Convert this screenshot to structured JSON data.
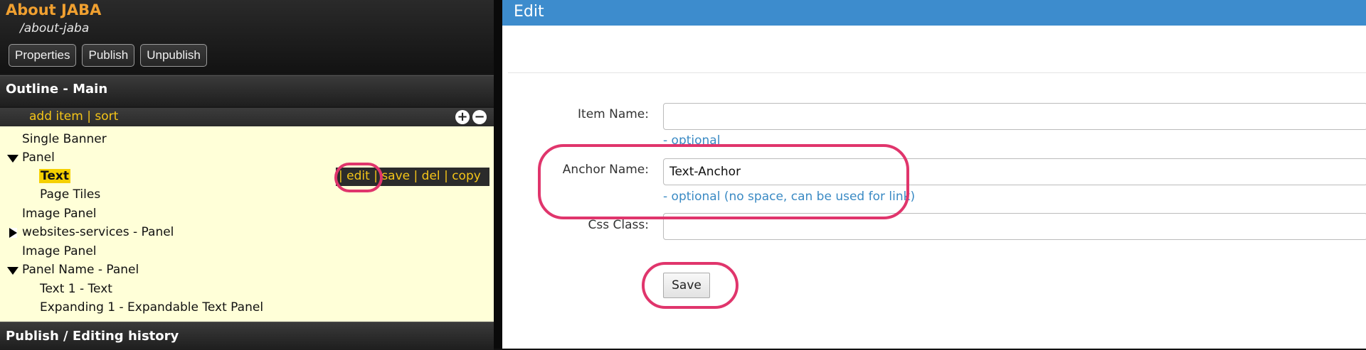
{
  "page": {
    "title": "About JABA",
    "path": "/about-jaba",
    "buttons": [
      "Properties",
      "Publish",
      "Unpublish"
    ]
  },
  "outline": {
    "title": "Outline - Main",
    "add_item": "add item",
    "sep": "|",
    "sort": "sort",
    "plus_icon": "+",
    "minus_icon": "−",
    "items": [
      {
        "label": "Single Banner",
        "indent": 1
      },
      {
        "label": "Panel",
        "indent": 1,
        "expanded": true
      },
      {
        "label": "Text",
        "indent": 2,
        "selected": true
      },
      {
        "label": "Page Tiles",
        "indent": 2
      },
      {
        "label": "Image Panel",
        "indent": 1
      },
      {
        "label": "websites-services - Panel",
        "indent": 1,
        "collapsed": true
      },
      {
        "label": "Image Panel",
        "indent": 1
      },
      {
        "label": "Panel Name - Panel",
        "indent": 1,
        "expanded": true
      },
      {
        "label": "Text 1 - Text",
        "indent": 2
      },
      {
        "label": "Expanding 1 - Expandable Text Panel",
        "indent": 2
      }
    ],
    "row_tools": {
      "edit": "edit",
      "save": "save",
      "del": "del",
      "copy": "copy",
      "sep": "|"
    }
  },
  "history": {
    "title": "Publish / Editing history"
  },
  "edit": {
    "title": "Edit",
    "item_name_label": "Item Name:",
    "item_name_value": "",
    "item_name_hint": "- optional",
    "anchor_label": "Anchor Name:",
    "anchor_value": "Text-Anchor",
    "anchor_hint": "- optional (no space, can be used for link)",
    "css_label": "Css Class:",
    "css_value": "",
    "save_label": "Save"
  },
  "colors": {
    "accent_orange": "#f0a030",
    "accent_yellow": "#f5c518",
    "edit_bar_blue": "#3d8ccd",
    "highlight_ring": "#e0356c",
    "tree_bg": "#ffffd8"
  }
}
